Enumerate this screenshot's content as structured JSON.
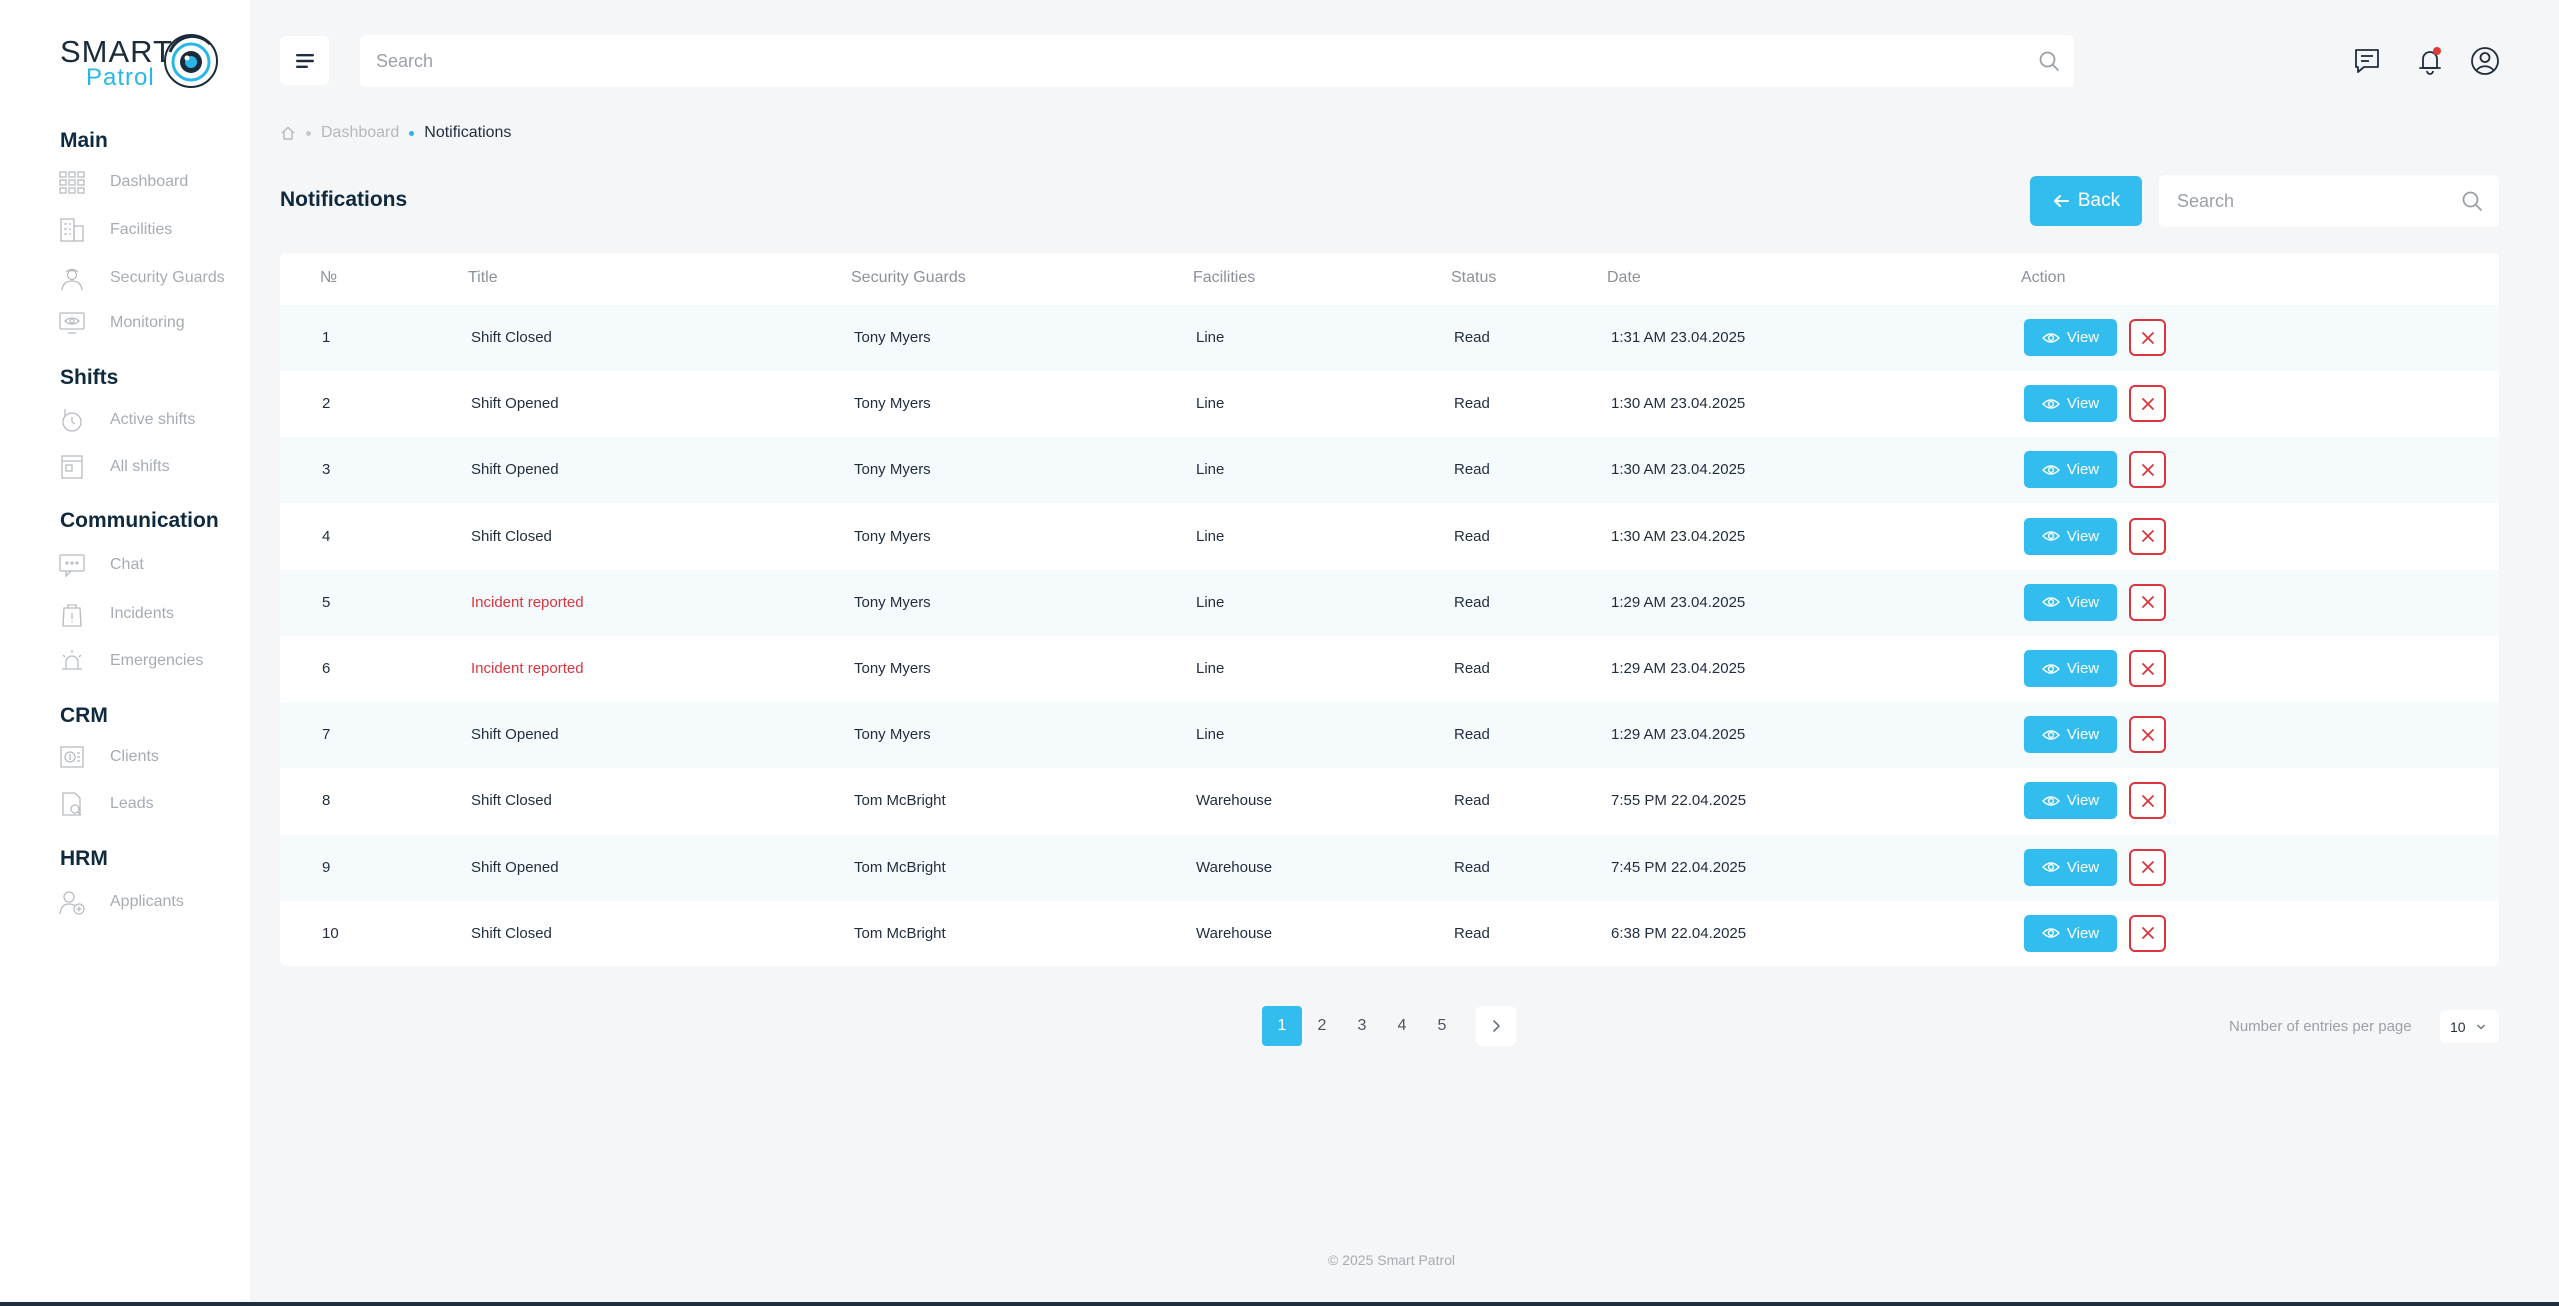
{
  "logo": {
    "word1": "SMART",
    "word2": "Patrol"
  },
  "sidebar": {
    "sections": [
      {
        "title": "Main",
        "items": [
          {
            "label": "Dashboard",
            "icon": "dashboard-grid-icon"
          },
          {
            "label": "Facilities",
            "icon": "building-icon"
          },
          {
            "label": "Security Guards",
            "icon": "guard-icon"
          },
          {
            "label": "Monitoring",
            "icon": "monitor-eye-icon"
          }
        ]
      },
      {
        "title": "Shifts",
        "items": [
          {
            "label": "Active shifts",
            "icon": "hand-clock-icon"
          },
          {
            "label": "All shifts",
            "icon": "calendar-book-icon"
          }
        ]
      },
      {
        "title": "Communication",
        "items": [
          {
            "label": "Chat",
            "icon": "chat-icon"
          },
          {
            "label": "Incidents",
            "icon": "incident-bag-icon"
          },
          {
            "label": "Emergencies",
            "icon": "siren-icon"
          }
        ]
      },
      {
        "title": "CRM",
        "items": [
          {
            "label": "Clients",
            "icon": "clients-icon"
          },
          {
            "label": "Leads",
            "icon": "leads-doc-icon"
          }
        ]
      },
      {
        "title": "HRM",
        "items": [
          {
            "label": "Applicants",
            "icon": "applicant-add-icon"
          }
        ]
      }
    ]
  },
  "topbar": {
    "search_placeholder": "Search"
  },
  "breadcrumb": {
    "dashboard": "Dashboard",
    "current": "Notifications"
  },
  "page": {
    "title": "Notifications",
    "back_label": "Back",
    "search_placeholder": "Search"
  },
  "table": {
    "headers": {
      "num": "№",
      "title": "Title",
      "guards": "Security Guards",
      "facilities": "Facilities",
      "status": "Status",
      "date": "Date",
      "action": "Action"
    },
    "view_label": "View",
    "rows": [
      {
        "num": "1",
        "title": "Shift Closed",
        "guard": "Tony Myers",
        "facility": "Line",
        "status": "Read",
        "date": "1:31 AM 23.04.2025",
        "incident": false
      },
      {
        "num": "2",
        "title": "Shift Opened",
        "guard": "Tony Myers",
        "facility": "Line",
        "status": "Read",
        "date": "1:30 AM 23.04.2025",
        "incident": false
      },
      {
        "num": "3",
        "title": "Shift Opened",
        "guard": "Tony Myers",
        "facility": "Line",
        "status": "Read",
        "date": "1:30 AM 23.04.2025",
        "incident": false
      },
      {
        "num": "4",
        "title": "Shift Closed",
        "guard": "Tony Myers",
        "facility": "Line",
        "status": "Read",
        "date": "1:30 AM 23.04.2025",
        "incident": false
      },
      {
        "num": "5",
        "title": "Incident reported",
        "guard": "Tony Myers",
        "facility": "Line",
        "status": "Read",
        "date": "1:29 AM 23.04.2025",
        "incident": true
      },
      {
        "num": "6",
        "title": "Incident reported",
        "guard": "Tony Myers",
        "facility": "Line",
        "status": "Read",
        "date": "1:29 AM 23.04.2025",
        "incident": true
      },
      {
        "num": "7",
        "title": "Shift Opened",
        "guard": "Tony Myers",
        "facility": "Line",
        "status": "Read",
        "date": "1:29 AM 23.04.2025",
        "incident": false
      },
      {
        "num": "8",
        "title": "Shift Closed",
        "guard": "Tom McBright",
        "facility": "Warehouse",
        "status": "Read",
        "date": "7:55 PM 22.04.2025",
        "incident": false
      },
      {
        "num": "9",
        "title": "Shift Opened",
        "guard": "Tom McBright",
        "facility": "Warehouse",
        "status": "Read",
        "date": "7:45 PM 22.04.2025",
        "incident": false
      },
      {
        "num": "10",
        "title": "Shift Closed",
        "guard": "Tom McBright",
        "facility": "Warehouse",
        "status": "Read",
        "date": "6:38 PM 22.04.2025",
        "incident": false
      }
    ]
  },
  "pagination": {
    "pages": [
      "1",
      "2",
      "3",
      "4",
      "5"
    ],
    "current": "1"
  },
  "entries": {
    "label": "Number of entries per page",
    "value": "10"
  },
  "footer": {
    "text": "© 2025 Smart Patrol"
  },
  "colors": {
    "accent": "#33bdef",
    "danger": "#d9363e",
    "heading": "#0f2a3f"
  }
}
